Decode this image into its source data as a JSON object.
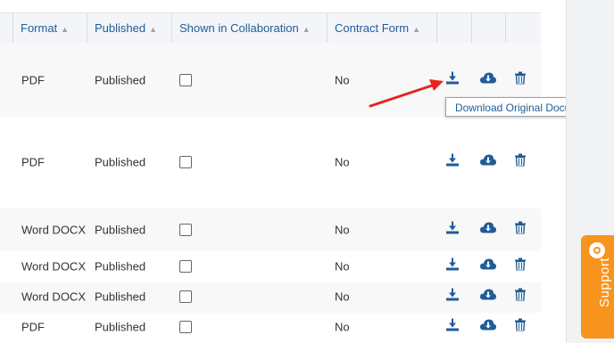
{
  "table": {
    "headers": [
      {
        "label": "Format",
        "caret": "▲"
      },
      {
        "label": "Published",
        "caret": "▲"
      },
      {
        "label": "Shown in Collaboration",
        "caret": "▲"
      },
      {
        "label": "Contract Form",
        "caret": "▲"
      }
    ],
    "rows": [
      {
        "format": "PDF",
        "published": "Published",
        "collab": false,
        "contract_form": "No"
      },
      {
        "format": "PDF",
        "published": "Published",
        "collab": false,
        "contract_form": "No"
      },
      {
        "format": "Word DOCX",
        "published": "Published",
        "collab": false,
        "contract_form": "No"
      },
      {
        "format": "Word DOCX",
        "published": "Published",
        "collab": false,
        "contract_form": "No"
      },
      {
        "format": "Word DOCX",
        "published": "Published",
        "collab": false,
        "contract_form": "No"
      },
      {
        "format": "PDF",
        "published": "Published",
        "collab": false,
        "contract_form": "No"
      }
    ],
    "row_actions": [
      "download-icon",
      "cloud-download-icon",
      "trash-icon"
    ]
  },
  "tooltip": {
    "text": "Download Original Document"
  },
  "support": {
    "label": "Support"
  },
  "colors": {
    "icon": "#1f5c99",
    "accent_orange": "#f7941d",
    "arrow_red": "#e8231f",
    "header_text": "#1f5c99"
  }
}
